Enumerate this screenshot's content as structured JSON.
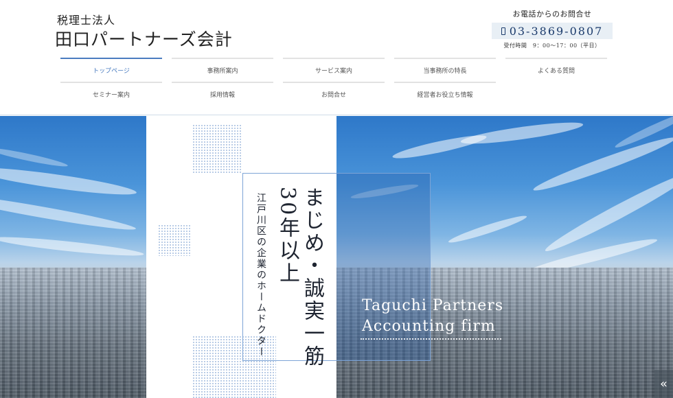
{
  "brand": {
    "subtitle": "税理士法人",
    "title": "田口パートナーズ会計"
  },
  "contact": {
    "label": "お電話からのお問合せ",
    "phone": "03-3869-0807",
    "hours": "受付時間　9：00～17：00（平日）",
    "phone_icon": "phone-icon"
  },
  "nav": {
    "row1": [
      "トップページ",
      "事務所案内",
      "サービス案内",
      "当事務所の特長",
      "よくある質問"
    ],
    "row2": [
      "セミナー案内",
      "採用情報",
      "お問合せ",
      "経営者お役立ち情報"
    ],
    "active": "トップページ",
    "accent_color": "#4a7cc0"
  },
  "hero": {
    "catch_main": "まじめ・誠実一筋30年以上",
    "catch_sub": "江戸川区の企業のホームドクター",
    "en_line1": "Taguchi Partners",
    "en_line2": "Accounting firm",
    "scroll_label": "«"
  }
}
